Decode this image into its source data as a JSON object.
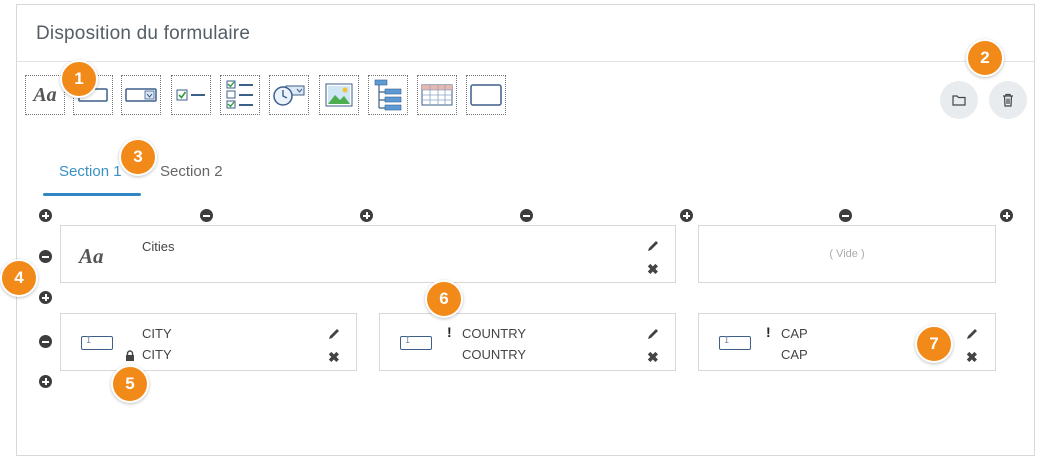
{
  "header": {
    "title": "Disposition du formulaire"
  },
  "toolbar": {
    "text_tool_glyph": "Aa",
    "tools": [
      "text-tool",
      "input-tool",
      "dropdown-tool",
      "checkbox-tool",
      "checklist-tool",
      "date-tool",
      "image-tool",
      "tree-tool",
      "table-tool",
      "box-tool"
    ]
  },
  "tabs": [
    {
      "label": "Section 1",
      "active": true
    },
    {
      "label": "Section 2",
      "active": false
    }
  ],
  "fields": {
    "row1": {
      "cities": {
        "glyph": "Aa",
        "label": "Cities"
      },
      "empty": {
        "label": "( Vide )"
      }
    },
    "row2": {
      "city": {
        "label": "CITY",
        "sublabel": "CITY",
        "locked": true,
        "required": false
      },
      "country": {
        "label": "COUNTRY",
        "sublabel": "COUNTRY",
        "required": true,
        "required_mark": "!"
      },
      "cap": {
        "label": "CAP",
        "sublabel": "CAP",
        "required": true,
        "required_mark": "!"
      }
    }
  },
  "badges": [
    "1",
    "2",
    "3",
    "4",
    "5",
    "6",
    "7"
  ],
  "colors": {
    "accent": "#2f86c2",
    "badge": "#f18a19",
    "control": "#3d3d3d",
    "border": "#d8d8d8"
  }
}
